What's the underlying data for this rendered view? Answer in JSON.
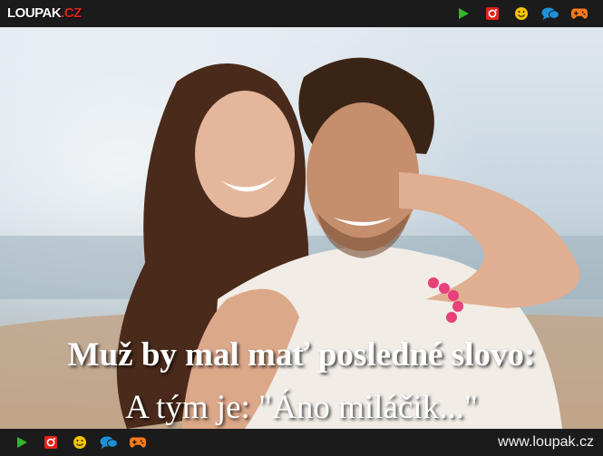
{
  "header": {
    "logo_main": "LOUPAK",
    "logo_tld": ".CZ",
    "icons": [
      "play-icon",
      "instagram-icon",
      "smiley-icon",
      "chat-icon",
      "gamepad-icon"
    ]
  },
  "meme": {
    "line1": "Muž by mal mať posledné slovo:",
    "line2": "A tým je: \"Áno miláčik...\""
  },
  "footer": {
    "url": "www.loupak.cz",
    "icons": [
      "play-icon",
      "instagram-icon",
      "smiley-icon",
      "chat-icon",
      "gamepad-icon"
    ]
  },
  "colors": {
    "play": "#2eb82e",
    "instagram": "#e2231a",
    "smiley": "#f5c400",
    "chat": "#1e90d6",
    "gamepad": "#ff7a1a"
  }
}
